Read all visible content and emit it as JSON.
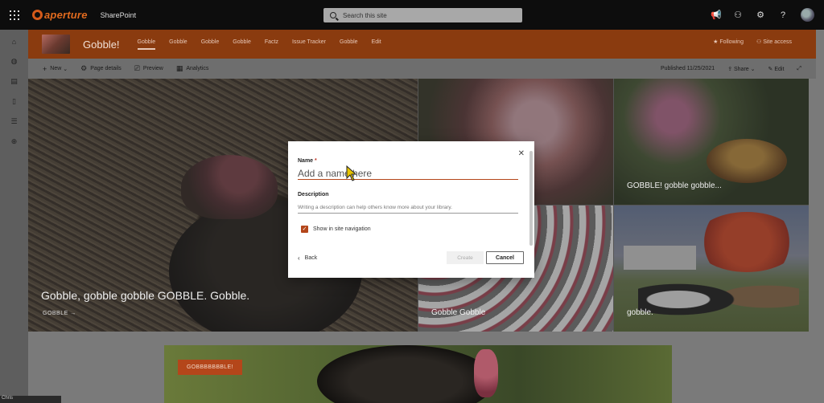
{
  "suitebar": {
    "brand": "aperture",
    "app_name": "SharePoint",
    "search_placeholder": "Search this site"
  },
  "site": {
    "title": "Gobble!",
    "nav": [
      "Gobble",
      "Gobble",
      "Gobble",
      "Gobble",
      "Factz",
      "Issue Tracker",
      "Gobble",
      "Edit"
    ],
    "following": "Following",
    "site_access": "Site access"
  },
  "commandbar": {
    "new": "New",
    "page_details": "Page details",
    "preview": "Preview",
    "analytics": "Analytics",
    "published": "Published 11/25/2021",
    "share": "Share",
    "edit": "Edit"
  },
  "hero": {
    "main_caption": "Gobble, gobble gobble GOBBLE. Gobble.",
    "main_link": "GOBBLE →",
    "tile_b_caption": "GOBBLE! gobble gobble...",
    "tile_c_caption": "Gobble Gobble",
    "tile_d_caption": "gobble."
  },
  "banner": {
    "button": "GOBBBBBBBLE!"
  },
  "bottom_strip": "Chris",
  "modal": {
    "name_label": "Name",
    "required_mark": "*",
    "name_placeholder": "Add a name here",
    "description_label": "Description",
    "description_placeholder": "Writing a description can help others know more about your library.",
    "checkbox_label": "Show in site navigation",
    "checkbox_checked": true,
    "back": "Back",
    "create": "Create",
    "cancel": "Cancel"
  },
  "colors": {
    "accent": "#b4461a",
    "header": "#8a3b0f"
  }
}
